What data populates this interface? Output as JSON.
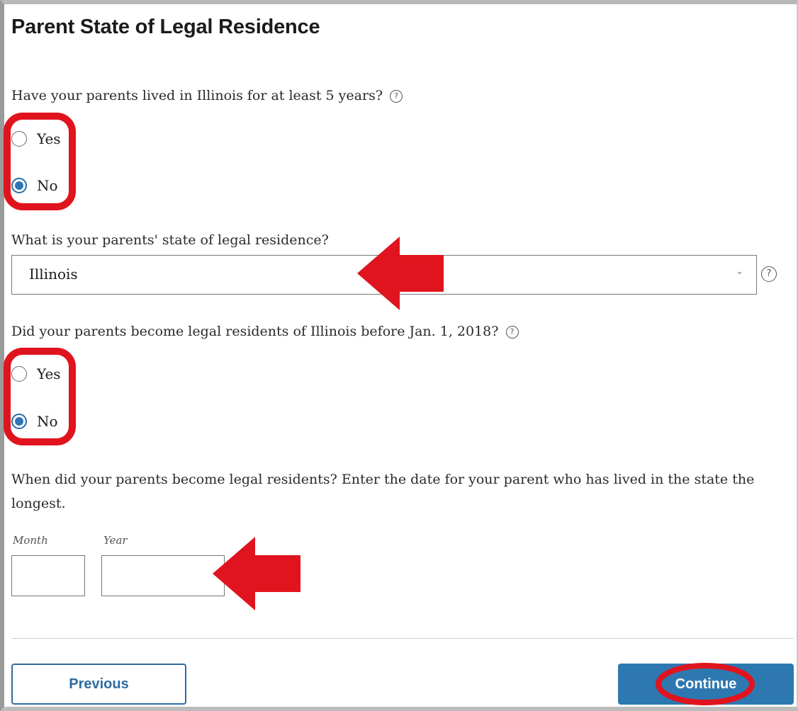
{
  "page": {
    "title": "Parent State of Legal Residence"
  },
  "q1": {
    "text": "Have your parents lived in Illinois for at least 5 years?",
    "help": "?",
    "options": [
      {
        "label": "Yes",
        "checked": false
      },
      {
        "label": "No",
        "checked": true
      }
    ]
  },
  "q2": {
    "text": "What is your parents' state of legal residence?",
    "selected": "Illinois",
    "chevron": "⌄",
    "help": "?"
  },
  "q3": {
    "text": "Did your parents become legal residents of Illinois before Jan. 1, 2018?",
    "help": "?",
    "options": [
      {
        "label": "Yes",
        "checked": false
      },
      {
        "label": "No",
        "checked": true
      }
    ]
  },
  "q4": {
    "text": "When did your parents become legal residents? Enter the date for your parent who has lived in the state the longest.",
    "month_label": "Month",
    "year_label": "Year",
    "month_value": "",
    "year_value": ""
  },
  "actions": {
    "previous_label": "Previous",
    "continue_label": "Continue"
  },
  "colors": {
    "accent": "#2e78b1",
    "annotation": "#e0141e"
  },
  "icons": [
    "help-icon",
    "chevron-down-icon",
    "arrow-left-icon"
  ]
}
